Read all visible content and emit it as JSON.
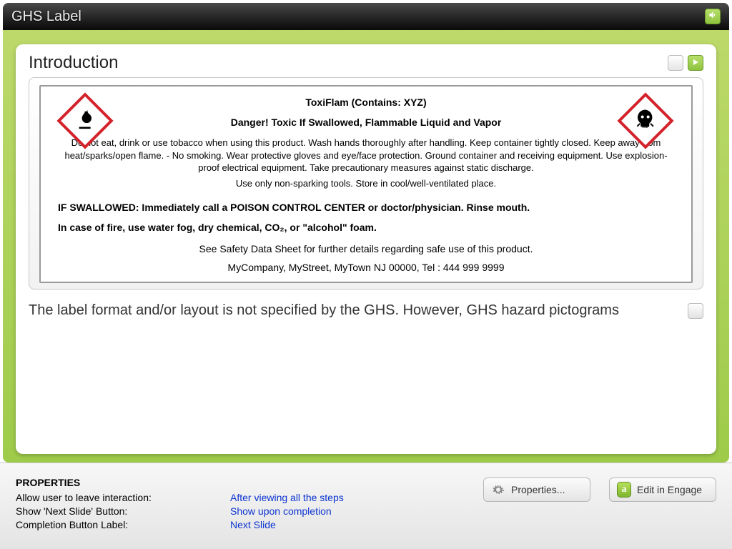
{
  "titlebar": {
    "title": "GHS Label"
  },
  "card": {
    "title": "Introduction"
  },
  "label": {
    "product": "ToxiFlam (Contains: XYZ)",
    "signal": "Danger! Toxic If Swallowed, Flammable Liquid and Vapor",
    "precaution1": "Do not eat, drink or use tobacco when using this product. Wash hands thoroughly after handling. Keep container tightly closed. Keep away from heat/sparks/open flame. - No smoking. Wear protective gloves and eye/face protection. Ground container and receiving equipment. Use explosion-proof electrical equipment. Take precautionary measures against static discharge.",
    "precaution2": "Use only non-sparking tools. Store in cool/well-ventilated place.",
    "firstaid": "IF SWALLOWED: Immediately call a POISON CONTROL CENTER or doctor/physician. Rinse mouth.",
    "fire": "In case of fire, use water fog, dry chemical, CO₂, or \"alcohol\" foam.",
    "sds": "See Safety Data Sheet for further details regarding safe use of this product.",
    "company": "MyCompany, MyStreet, MyTown NJ 00000, Tel : 444 999 9999"
  },
  "caption": {
    "text": "The label format and/or layout is not specified by the GHS. However, GHS hazard pictograms"
  },
  "properties": {
    "heading": "PROPERTIES",
    "rows": [
      {
        "label": "Allow user to leave interaction:",
        "value": "After viewing all the steps"
      },
      {
        "label": "Show 'Next Slide' Button:",
        "value": "Show upon completion"
      },
      {
        "label": "Completion Button Label:",
        "value": "Next Slide"
      }
    ],
    "properties_btn": "Properties...",
    "engage_btn": "Edit in Engage",
    "engage_badge": "a"
  }
}
